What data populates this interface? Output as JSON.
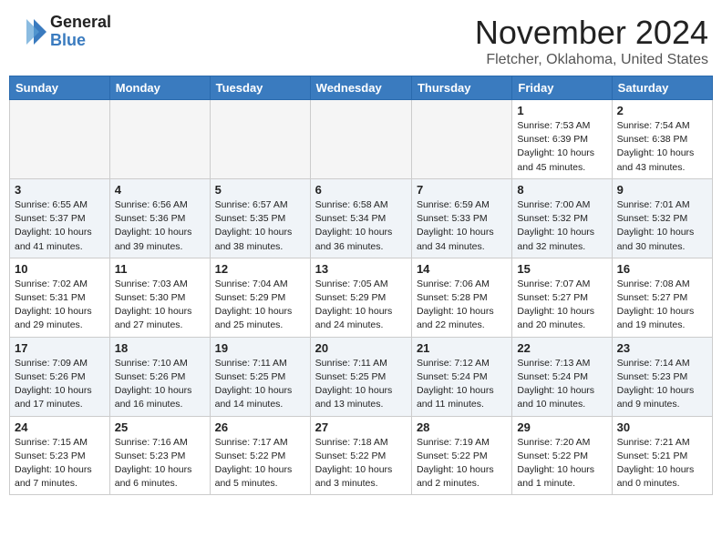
{
  "header": {
    "logo_general": "General",
    "logo_blue": "Blue",
    "month": "November 2024",
    "location": "Fletcher, Oklahoma, United States"
  },
  "weekdays": [
    "Sunday",
    "Monday",
    "Tuesday",
    "Wednesday",
    "Thursday",
    "Friday",
    "Saturday"
  ],
  "weeks": [
    [
      {
        "day": "",
        "info": ""
      },
      {
        "day": "",
        "info": ""
      },
      {
        "day": "",
        "info": ""
      },
      {
        "day": "",
        "info": ""
      },
      {
        "day": "",
        "info": ""
      },
      {
        "day": "1",
        "info": "Sunrise: 7:53 AM\nSunset: 6:39 PM\nDaylight: 10 hours\nand 45 minutes."
      },
      {
        "day": "2",
        "info": "Sunrise: 7:54 AM\nSunset: 6:38 PM\nDaylight: 10 hours\nand 43 minutes."
      }
    ],
    [
      {
        "day": "3",
        "info": "Sunrise: 6:55 AM\nSunset: 5:37 PM\nDaylight: 10 hours\nand 41 minutes."
      },
      {
        "day": "4",
        "info": "Sunrise: 6:56 AM\nSunset: 5:36 PM\nDaylight: 10 hours\nand 39 minutes."
      },
      {
        "day": "5",
        "info": "Sunrise: 6:57 AM\nSunset: 5:35 PM\nDaylight: 10 hours\nand 38 minutes."
      },
      {
        "day": "6",
        "info": "Sunrise: 6:58 AM\nSunset: 5:34 PM\nDaylight: 10 hours\nand 36 minutes."
      },
      {
        "day": "7",
        "info": "Sunrise: 6:59 AM\nSunset: 5:33 PM\nDaylight: 10 hours\nand 34 minutes."
      },
      {
        "day": "8",
        "info": "Sunrise: 7:00 AM\nSunset: 5:32 PM\nDaylight: 10 hours\nand 32 minutes."
      },
      {
        "day": "9",
        "info": "Sunrise: 7:01 AM\nSunset: 5:32 PM\nDaylight: 10 hours\nand 30 minutes."
      }
    ],
    [
      {
        "day": "10",
        "info": "Sunrise: 7:02 AM\nSunset: 5:31 PM\nDaylight: 10 hours\nand 29 minutes."
      },
      {
        "day": "11",
        "info": "Sunrise: 7:03 AM\nSunset: 5:30 PM\nDaylight: 10 hours\nand 27 minutes."
      },
      {
        "day": "12",
        "info": "Sunrise: 7:04 AM\nSunset: 5:29 PM\nDaylight: 10 hours\nand 25 minutes."
      },
      {
        "day": "13",
        "info": "Sunrise: 7:05 AM\nSunset: 5:29 PM\nDaylight: 10 hours\nand 24 minutes."
      },
      {
        "day": "14",
        "info": "Sunrise: 7:06 AM\nSunset: 5:28 PM\nDaylight: 10 hours\nand 22 minutes."
      },
      {
        "day": "15",
        "info": "Sunrise: 7:07 AM\nSunset: 5:27 PM\nDaylight: 10 hours\nand 20 minutes."
      },
      {
        "day": "16",
        "info": "Sunrise: 7:08 AM\nSunset: 5:27 PM\nDaylight: 10 hours\nand 19 minutes."
      }
    ],
    [
      {
        "day": "17",
        "info": "Sunrise: 7:09 AM\nSunset: 5:26 PM\nDaylight: 10 hours\nand 17 minutes."
      },
      {
        "day": "18",
        "info": "Sunrise: 7:10 AM\nSunset: 5:26 PM\nDaylight: 10 hours\nand 16 minutes."
      },
      {
        "day": "19",
        "info": "Sunrise: 7:11 AM\nSunset: 5:25 PM\nDaylight: 10 hours\nand 14 minutes."
      },
      {
        "day": "20",
        "info": "Sunrise: 7:11 AM\nSunset: 5:25 PM\nDaylight: 10 hours\nand 13 minutes."
      },
      {
        "day": "21",
        "info": "Sunrise: 7:12 AM\nSunset: 5:24 PM\nDaylight: 10 hours\nand 11 minutes."
      },
      {
        "day": "22",
        "info": "Sunrise: 7:13 AM\nSunset: 5:24 PM\nDaylight: 10 hours\nand 10 minutes."
      },
      {
        "day": "23",
        "info": "Sunrise: 7:14 AM\nSunset: 5:23 PM\nDaylight: 10 hours\nand 9 minutes."
      }
    ],
    [
      {
        "day": "24",
        "info": "Sunrise: 7:15 AM\nSunset: 5:23 PM\nDaylight: 10 hours\nand 7 minutes."
      },
      {
        "day": "25",
        "info": "Sunrise: 7:16 AM\nSunset: 5:23 PM\nDaylight: 10 hours\nand 6 minutes."
      },
      {
        "day": "26",
        "info": "Sunrise: 7:17 AM\nSunset: 5:22 PM\nDaylight: 10 hours\nand 5 minutes."
      },
      {
        "day": "27",
        "info": "Sunrise: 7:18 AM\nSunset: 5:22 PM\nDaylight: 10 hours\nand 3 minutes."
      },
      {
        "day": "28",
        "info": "Sunrise: 7:19 AM\nSunset: 5:22 PM\nDaylight: 10 hours\nand 2 minutes."
      },
      {
        "day": "29",
        "info": "Sunrise: 7:20 AM\nSunset: 5:22 PM\nDaylight: 10 hours\nand 1 minute."
      },
      {
        "day": "30",
        "info": "Sunrise: 7:21 AM\nSunset: 5:21 PM\nDaylight: 10 hours\nand 0 minutes."
      }
    ]
  ]
}
